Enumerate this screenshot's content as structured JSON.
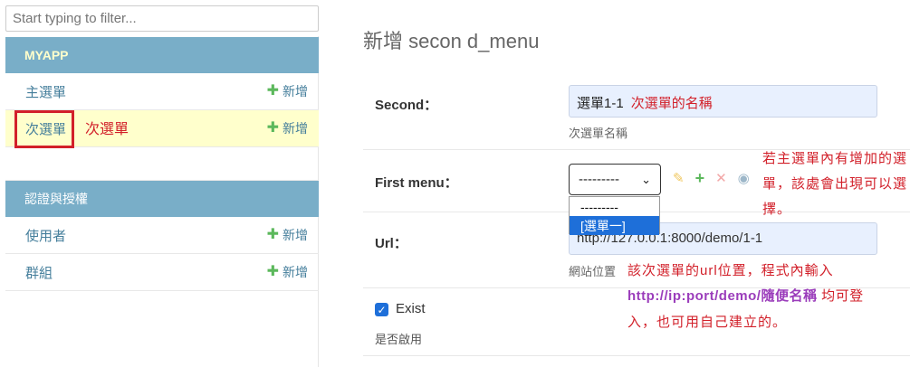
{
  "sidebar": {
    "filter_placeholder": "Start typing to filter...",
    "modules": [
      {
        "name": "MYAPP",
        "models": [
          {
            "label": "主選單",
            "add": "新增"
          },
          {
            "label": "次選單",
            "add": "新增"
          }
        ]
      },
      {
        "name": "認證與授權",
        "models": [
          {
            "label": "使用者",
            "add": "新增"
          },
          {
            "label": "群組",
            "add": "新增"
          }
        ]
      }
    ],
    "annotation": "次選單"
  },
  "main": {
    "title": "新增 secon d_menu",
    "fields": {
      "second": {
        "label": "Second：",
        "value": "選單1-1",
        "annotation": "次選單的名稱",
        "help": "次選單名稱"
      },
      "first_menu": {
        "label": "First menu：",
        "selected": "---------",
        "options": [
          "---------",
          "[選單一]"
        ],
        "annotation": "若主選單內有增加的選單，該處會出現可以選擇。"
      },
      "url": {
        "label": "Url：",
        "value": "http://127.0.0.1:8000/demo/1-1",
        "help": "網站位置",
        "annotation_line1": "該次選單的url位置，程式內輸入",
        "annotation_line2_purple": "http://ip:port/demo/隨便名稱",
        "annotation_line2_red": " 均可登",
        "annotation_line3": "入，也可用自己建立的。"
      },
      "exist": {
        "label": "Exist",
        "checked": true,
        "help": "是否啟用"
      }
    }
  },
  "icons": {
    "add": "plus-icon",
    "edit": "pencil-icon",
    "delete": "x-icon",
    "view": "eye-icon"
  },
  "colors": {
    "module_header": "#79aec8",
    "link": "#447e9b",
    "highlight_row": "#ffffcc",
    "annotation_red": "#d2202a",
    "annotation_purple": "#9b3dbb",
    "add_green": "#5cb85c"
  }
}
